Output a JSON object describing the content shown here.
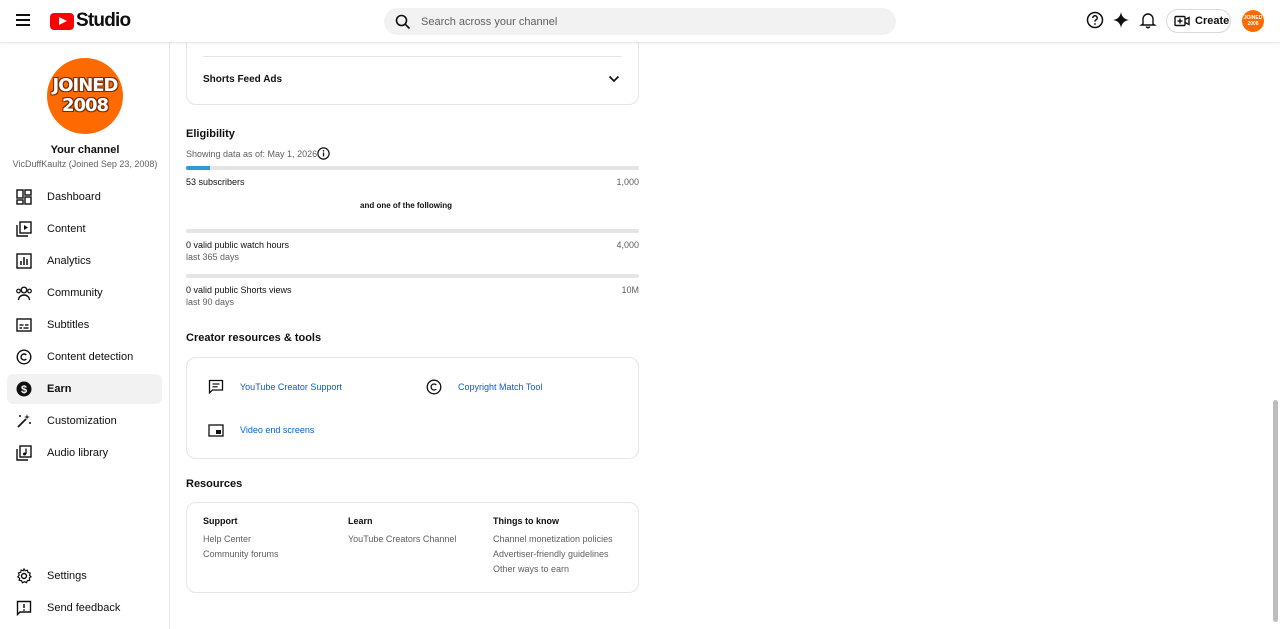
{
  "header": {
    "logo_text": "Studio",
    "search_placeholder": "Search across your channel",
    "create_label": "Create",
    "avatar_text": "JOINED 2008"
  },
  "sidebar": {
    "avatar_line1": "JOINED",
    "avatar_line2": "2008",
    "channel_title": "Your channel",
    "channel_sub": "VicDuffKaultz (Joined Sep 23, 2008)",
    "items": [
      {
        "label": "Dashboard",
        "icon": "dashboard-icon"
      },
      {
        "label": "Content",
        "icon": "content-icon"
      },
      {
        "label": "Analytics",
        "icon": "analytics-icon"
      },
      {
        "label": "Community",
        "icon": "community-icon"
      },
      {
        "label": "Subtitles",
        "icon": "subtitles-icon"
      },
      {
        "label": "Content detection",
        "icon": "copyright-icon"
      },
      {
        "label": "Earn",
        "icon": "dollar-icon",
        "active": true
      },
      {
        "label": "Customization",
        "icon": "magic-wand-icon"
      },
      {
        "label": "Audio library",
        "icon": "audio-library-icon"
      }
    ],
    "settings": "Settings",
    "feedback": "Send feedback"
  },
  "main": {
    "shorts_feed_ads": "Shorts Feed Ads",
    "eligibility": {
      "title": "Eligibility",
      "as_of": "Showing data as of: May 1, 2026",
      "subscribers": {
        "label": "53 subscribers",
        "goal": "1,000",
        "progress": 0.053
      },
      "and_one": "and one of the following",
      "watch_hours": {
        "label": "0 valid public watch hours",
        "period": "last 365 days",
        "goal": "4,000",
        "progress": 0
      },
      "shorts_views": {
        "label": "0 valid public Shorts views",
        "period": "last 90 days",
        "goal": "10M",
        "progress": 0
      }
    },
    "creator_tools": {
      "title": "Creator resources & tools",
      "support": "YouTube Creator Support",
      "copyright": "Copyright Match Tool",
      "end_screens": "Video end screens"
    },
    "resources": {
      "title": "Resources",
      "support_h": "Support",
      "help_center": "Help Center",
      "community_forums": "Community forums",
      "learn_h": "Learn",
      "creators_channel": "YouTube Creators Channel",
      "know_h": "Things to know",
      "monetization_policies": "Channel monetization policies",
      "advertiser_guidelines": "Advertiser-friendly guidelines",
      "other_ways": "Other ways to earn"
    }
  },
  "colors": {
    "accent": "#065fd4",
    "progress": "#2f9ad6",
    "brand": "#ff0000",
    "avatar": "#ff6a00"
  }
}
